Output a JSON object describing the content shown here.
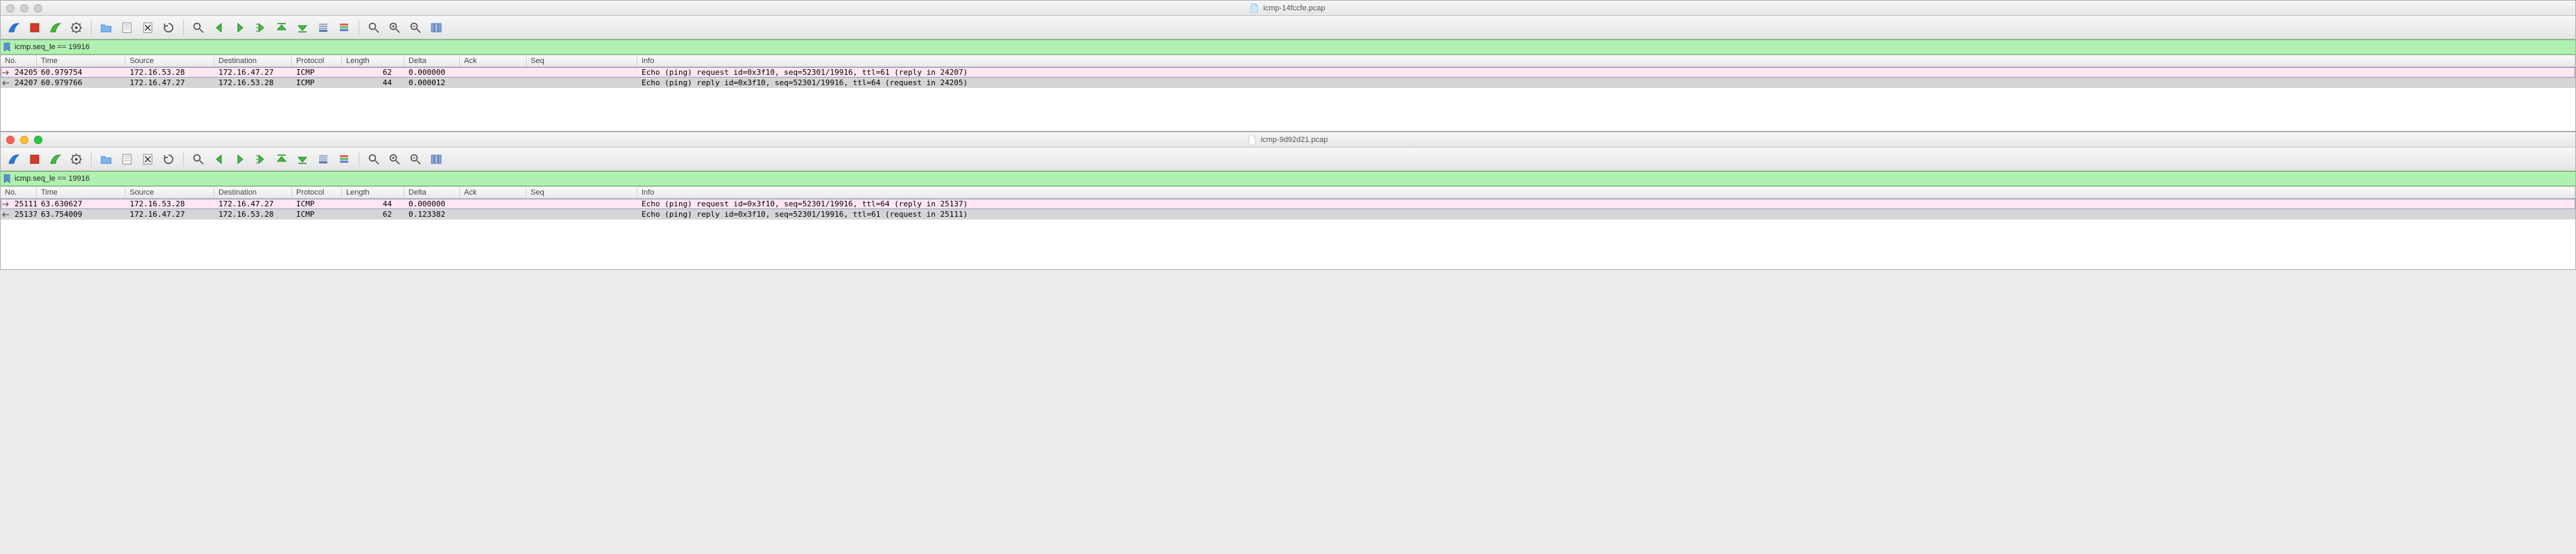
{
  "columns": [
    "No.",
    "Time",
    "Source",
    "Destination",
    "Protocol",
    "Length",
    "Delta",
    "Ack",
    "Seq",
    "Info"
  ],
  "windows": [
    {
      "title": "icmp-14fccfe.pcap",
      "traffic_style": "inactive",
      "filter": "icmp.seq_le == 19916",
      "rows": [
        {
          "dir": "right",
          "class": "pink",
          "no": "24205",
          "time": "60.979754",
          "src": "172.16.53.28",
          "dst": "172.16.47.27",
          "proto": "ICMP",
          "len": "62",
          "delta": "0.000000",
          "ack": "",
          "seq": "",
          "info": "Echo (ping) request  id=0x3f10, seq=52301/19916, ttl=61 (reply in 24207)"
        },
        {
          "dir": "left",
          "class": "grey",
          "no": "24207",
          "time": "60.979766",
          "src": "172.16.47.27",
          "dst": "172.16.53.28",
          "proto": "ICMP",
          "len": "44",
          "delta": "0.000012",
          "ack": "",
          "seq": "",
          "info": "Echo (ping) reply    id=0x3f10, seq=52301/19916, ttl=64 (request in 24205)"
        }
      ]
    },
    {
      "title": "icmp-9d92d21.pcap",
      "traffic_style": "active",
      "filter": "icmp.seq_le == 19916",
      "rows": [
        {
          "dir": "right",
          "class": "pink",
          "no": "25111",
          "time": "63.630627",
          "src": "172.16.53.28",
          "dst": "172.16.47.27",
          "proto": "ICMP",
          "len": "44",
          "delta": "0.000000",
          "ack": "",
          "seq": "",
          "info": "Echo (ping) request  id=0x3f10, seq=52301/19916, ttl=64 (reply in 25137)"
        },
        {
          "dir": "left",
          "class": "grey",
          "no": "25137",
          "time": "63.754009",
          "src": "172.16.47.27",
          "dst": "172.16.53.28",
          "proto": "ICMP",
          "len": "62",
          "delta": "0.123382",
          "ack": "",
          "seq": "",
          "info": "Echo (ping) reply    id=0x3f10, seq=52301/19916, ttl=61 (request in 25111)"
        }
      ]
    }
  ],
  "toolbar_icons": [
    "shark-fin-icon",
    "stop-capture-icon",
    "restart-capture-icon",
    "options-icon",
    "|",
    "open-file-icon",
    "save-file-icon",
    "close-file-icon",
    "reload-icon",
    "|",
    "find-icon",
    "back-icon",
    "forward-icon",
    "jump-icon",
    "top-icon",
    "bottom-icon",
    "autoscroll-icon",
    "colorize-icon",
    "|",
    "zoom-fit-icon",
    "zoom-in-icon",
    "zoom-out-icon",
    "columns-icon"
  ]
}
